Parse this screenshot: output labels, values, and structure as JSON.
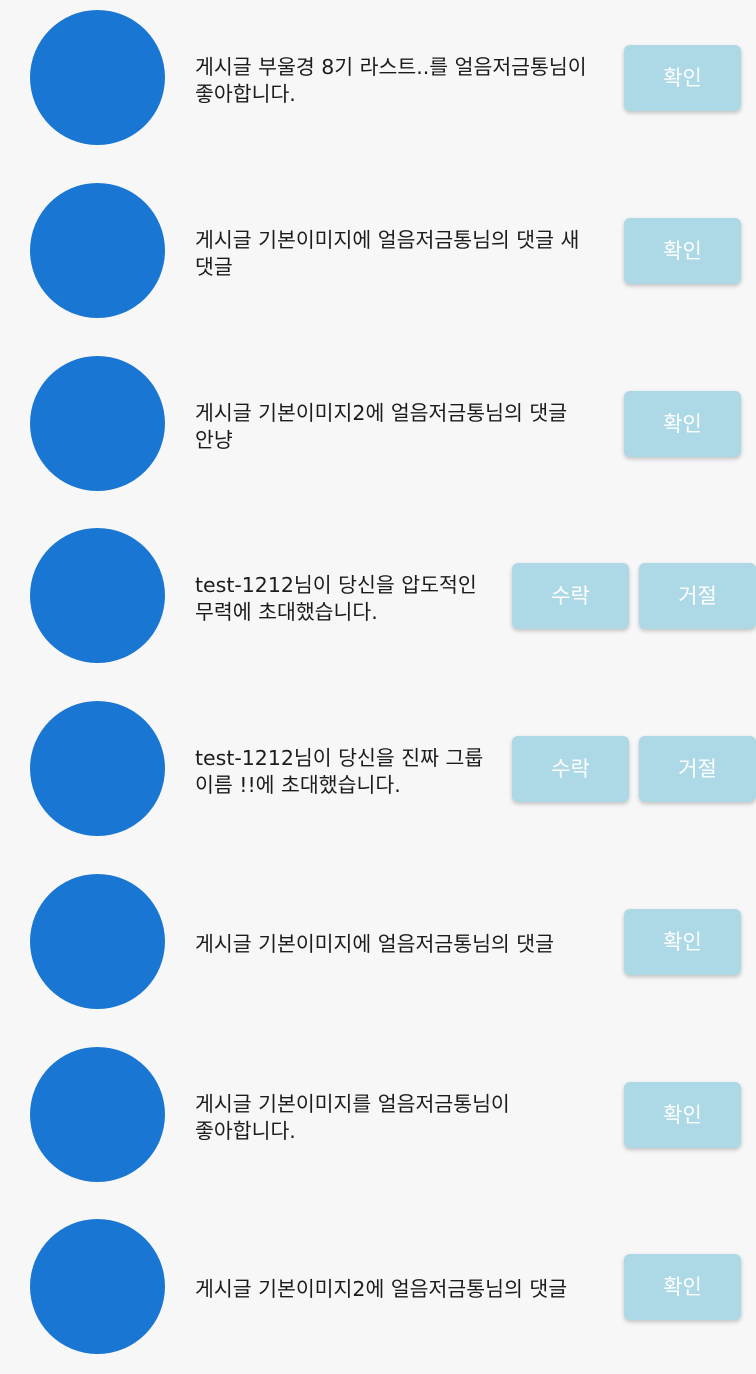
{
  "colors": {
    "background": "#f7f7f8",
    "avatar": "#1976d2",
    "button": "#add8e6",
    "button_text": "#ffffff"
  },
  "notifications": [
    {
      "text": "게시글 부울경 8기 라스트..를 얼음저금통님이 좋아합니다.",
      "type": "confirm",
      "confirm_label": "확인"
    },
    {
      "text": "게시글 기본이미지에 얼음저금통님의 댓글 새 댓글",
      "type": "confirm",
      "confirm_label": "확인"
    },
    {
      "text": "게시글 기본이미지2에 얼음저금통님의 댓글 안냥",
      "type": "confirm",
      "confirm_label": "확인"
    },
    {
      "text": "test-1212님이 당신을 압도적인 무력에 초대했습니다.",
      "type": "invite",
      "accept_label": "수락",
      "reject_label": "거절"
    },
    {
      "text": "test-1212님이 당신을 진짜 그룹 이름 !!에 초대했습니다.",
      "type": "invite",
      "accept_label": "수락",
      "reject_label": "거절"
    },
    {
      "text": "게시글 기본이미지에 얼음저금통님의 댓글",
      "type": "confirm",
      "confirm_label": "확인"
    },
    {
      "text": "게시글 기본이미지를 얼음저금통님이 좋아합니다.",
      "type": "confirm",
      "confirm_label": "확인"
    },
    {
      "text": "게시글 기본이미지2에 얼음저금통님의 댓글",
      "type": "confirm",
      "confirm_label": "확인"
    }
  ]
}
